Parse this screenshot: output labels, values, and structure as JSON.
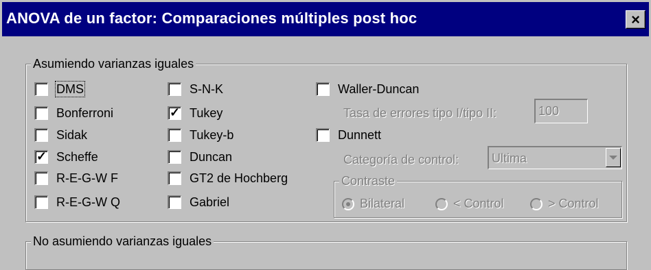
{
  "window": {
    "title": "ANOVA de un factor: Comparaciones múltiples post hoc",
    "close_glyph": "×"
  },
  "equal_variances": {
    "legend": "Asumiendo varianzas iguales",
    "col1": [
      {
        "label": "DMS",
        "checked": false
      },
      {
        "label": "Bonferroni",
        "checked": false
      },
      {
        "label": "Sidak",
        "checked": false
      },
      {
        "label": "Scheffe",
        "checked": true
      },
      {
        "label": "R-E-G-W F",
        "checked": false
      },
      {
        "label": "R-E-G-W Q",
        "checked": false
      }
    ],
    "col2": [
      {
        "label": "S-N-K",
        "checked": false
      },
      {
        "label": "Tukey",
        "checked": true
      },
      {
        "label": "Tukey-b",
        "checked": false
      },
      {
        "label": "Duncan",
        "checked": false
      },
      {
        "label": "GT2 de Hochberg",
        "checked": false
      },
      {
        "label": "Gabriel",
        "checked": false
      }
    ],
    "waller": {
      "label": "Waller-Duncan",
      "checked": false
    },
    "error_ratio_label": "Tasa de errores tipo I/tipo II:",
    "error_ratio_value": "100",
    "dunnett": {
      "label": "Dunnett",
      "checked": false
    },
    "control_category_label": "Categoría de control:",
    "control_category_value": "Ultima",
    "contrast": {
      "legend": "Contraste",
      "options": [
        "Bilateral",
        "< Control",
        "> Control"
      ],
      "selected": "Bilateral"
    }
  },
  "unequal_variances": {
    "legend": "No asumiendo varianzas iguales"
  }
}
